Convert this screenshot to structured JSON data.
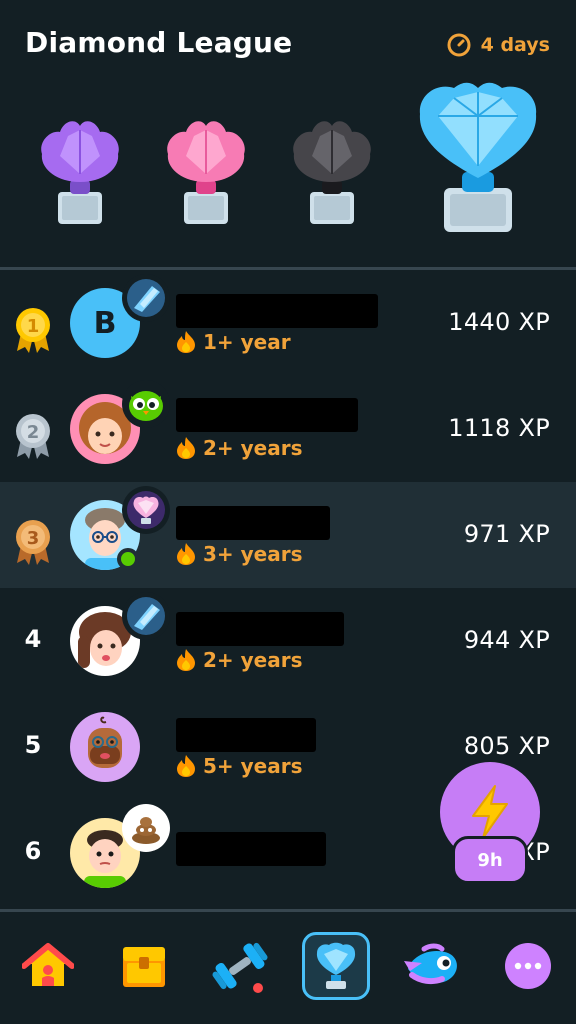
{
  "header": {
    "title": "Diamond League",
    "time_left": "4 days",
    "trophies": [
      "amethyst-trophy",
      "pearl-trophy",
      "obsidian-trophy",
      "diamond-trophy"
    ]
  },
  "leaderboard": [
    {
      "rank": "1",
      "avatar": "B",
      "streak": "1+ year",
      "xp": "1440 XP"
    },
    {
      "rank": "2",
      "streak": "2+ years",
      "xp": "1118 XP"
    },
    {
      "rank": "3",
      "streak": "3+ years",
      "xp": "971 XP"
    },
    {
      "rank": "4",
      "streak": "2+ years",
      "xp": "944 XP"
    },
    {
      "rank": "5",
      "streak": "5+ years",
      "xp": "805 XP"
    },
    {
      "rank": "6",
      "xp": "XP"
    }
  ],
  "boost": {
    "label": "9h"
  },
  "tabs": [
    "home",
    "quests",
    "practice",
    "leagues",
    "characters",
    "more"
  ],
  "colors": {
    "background": "#131f24",
    "highlight_row": "#202f36",
    "streak": "#f1a33a",
    "gold": "#ffc800",
    "silver": "#b8c4ce",
    "bronze": "#e8a04f",
    "accent": "#49c0f8",
    "boost": "#c67df6"
  }
}
